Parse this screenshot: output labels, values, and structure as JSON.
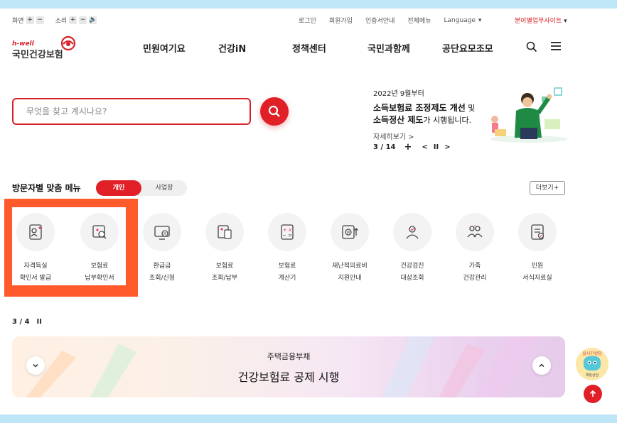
{
  "util": {
    "screen_label": "화면",
    "sound_label": "소리",
    "plus": "+",
    "minus": "−",
    "speaker": "🔈",
    "links": [
      "로그인",
      "회원가입",
      "인증서안내",
      "전체메뉴"
    ],
    "language": "Language",
    "family_site": "분야별업무사이트"
  },
  "logo": {
    "small": "h-well",
    "main": "국민건강보험"
  },
  "nav": [
    "민원여기요",
    "건강iN",
    "정책센터",
    "국민과함께",
    "공단요모조모"
  ],
  "search": {
    "placeholder": "무엇을 찾고 계시나요?"
  },
  "notice": {
    "date": "2022년 9월부터",
    "line1_bold": "소득보험료 조정제도 개선",
    "line1_tail": " 및",
    "line2_bold": "소득정산 제도",
    "line2_tail": "가 시행됩니다.",
    "more": "자세히보기 >",
    "counter": "3 / 14",
    "plus": "+",
    "prev": "<",
    "pause": "II",
    "next": ">"
  },
  "visitor": {
    "title": "방문자별 맞춤 메뉴",
    "tab_personal": "개인",
    "tab_business": "사업장",
    "more": "더보기+"
  },
  "services": [
    {
      "l1": "자격득실",
      "l2": "확인서 발급",
      "icon": "person-doc-icon"
    },
    {
      "l1": "보험료",
      "l2": "납부확인서",
      "icon": "doc-search-icon"
    },
    {
      "l1": "환급금",
      "l2": "조회/신청",
      "icon": "monitor-won-icon"
    },
    {
      "l1": "보험료",
      "l2": "조회/납부",
      "icon": "card-doc-icon"
    },
    {
      "l1": "보험료",
      "l2": "계산기",
      "icon": "calculator-icon"
    },
    {
      "l1": "재난적의료비",
      "l2": "지원안내",
      "icon": "won-up-icon"
    },
    {
      "l1": "건강검진",
      "l2": "대상조회",
      "icon": "people-check-icon"
    },
    {
      "l1": "가족",
      "l2": "건강관리",
      "icon": "family-icon"
    },
    {
      "l1": "민원",
      "l2": "서식자료실",
      "icon": "form-icon"
    }
  ],
  "pager": {
    "counter": "3 / 4",
    "pause": "II"
  },
  "banner": {
    "sub": "주택금융부채",
    "title": "건강보험료 공제 시행"
  },
  "chatbot": {
    "label": "실시간상담",
    "sub": "채팅상담"
  }
}
